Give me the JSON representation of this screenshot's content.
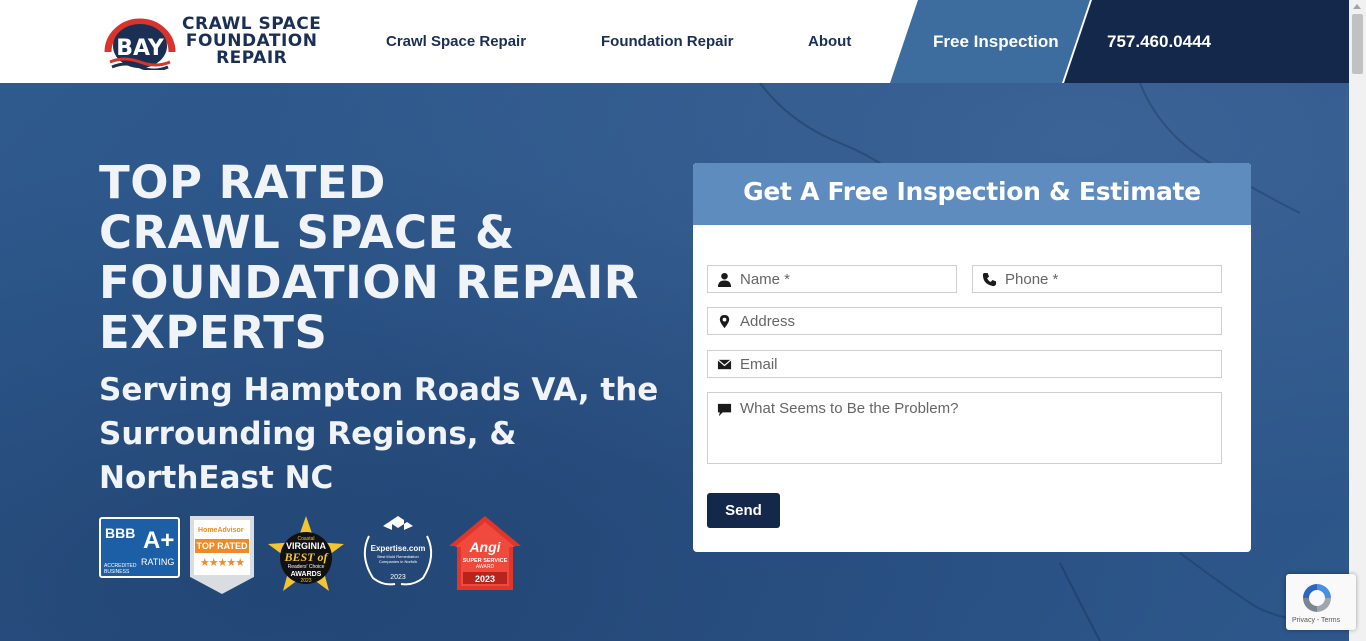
{
  "header": {
    "logo": {
      "badge_text": "BAY",
      "line1": "CRAWL SPACE",
      "line2": "FOUNDATION",
      "line3": "REPAIR"
    },
    "nav": [
      {
        "label": "Crawl Space Repair"
      },
      {
        "label": "Foundation Repair"
      },
      {
        "label": "About"
      }
    ],
    "cta_inspection": "Free Inspection",
    "cta_phone": "757.460.0444"
  },
  "hero": {
    "title_lines": [
      "TOP RATED",
      "CRAWL SPACE &",
      "FOUNDATION REPAIR",
      "EXPERTS"
    ],
    "subtitle": "Serving Hampton Roads VA, the Surrounding Regions, & NorthEast NC"
  },
  "badges": {
    "bbb": {
      "logo": "BBB",
      "grade": "A+",
      "rating": "RATING",
      "accredited": "ACCREDITED BUSINESS"
    },
    "homeadvisor": {
      "brand": "HomeAdvisor",
      "label": "TOP RATED",
      "stars": "★★★★★"
    },
    "virginia": {
      "line1": "Coastal",
      "line2": "VIRGINIA",
      "line3": "BEST of",
      "line4": "Readers' Choice",
      "line5": "AWARDS",
      "year": "2023"
    },
    "expertise": {
      "brand": "Expertise.com",
      "desc": "Best Mold Remediation Companies in Norfolk",
      "year": "2023"
    },
    "angi": {
      "brand": "Angi",
      "line1": "SUPER SERVICE",
      "line2": "AWARD",
      "year": "2023"
    }
  },
  "form": {
    "title": "Get A Free Inspection & Estimate",
    "fields": {
      "name": {
        "placeholder": "Name *",
        "value": ""
      },
      "phone": {
        "placeholder": "Phone *",
        "value": ""
      },
      "address": {
        "placeholder": "Address",
        "value": ""
      },
      "email": {
        "placeholder": "Email",
        "value": ""
      },
      "problem": {
        "placeholder": "What Seems to Be the Problem?",
        "value": ""
      }
    },
    "submit_label": "Send"
  },
  "recaptcha": {
    "text": "Privacy - Terms"
  },
  "colors": {
    "navy": "#13284a",
    "accent_blue": "#3d6d9f",
    "form_header": "#5e8cbf",
    "hero_bg": "#2e5688",
    "logo_red": "#d9342b"
  }
}
